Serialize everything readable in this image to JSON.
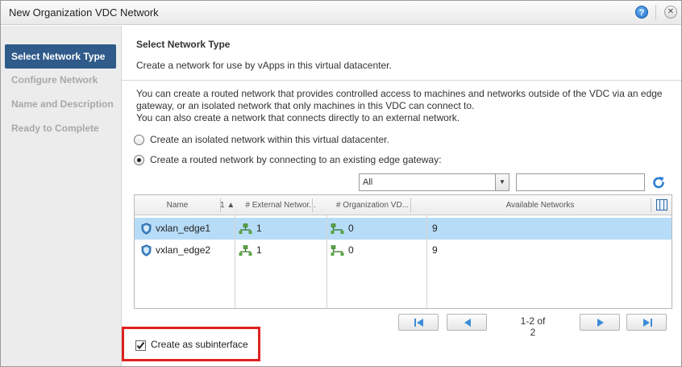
{
  "window": {
    "title": "New Organization VDC Network",
    "help_label": "?",
    "close_label": "⊗"
  },
  "steps": [
    {
      "label": "Select Network Type",
      "active": true
    },
    {
      "label": "Configure Network",
      "active": false
    },
    {
      "label": "Name and Description",
      "active": false
    },
    {
      "label": "Ready to Complete",
      "active": false
    }
  ],
  "page": {
    "title": "Select Network Type",
    "subtitle": "Create a network for use by vApps in this virtual datacenter.",
    "paragraph_lines": [
      "You can create a routed network that provides controlled access to machines and networks outside of the VDC via an edge",
      "gateway, or an isolated network that only machines in this VDC can connect to.",
      "You can also create a network that connects directly to an external network."
    ]
  },
  "options": [
    {
      "label": "Create an isolated network within this virtual datacenter.",
      "checked": false
    },
    {
      "label": "Create a routed network by connecting to an existing edge gateway:",
      "checked": true
    }
  ],
  "filter": {
    "select_value": "All",
    "search_value": "",
    "search_placeholder": ""
  },
  "grid": {
    "columns": [
      "Name",
      "1 ▲",
      "# External Networ...",
      "# Organization VD...",
      "Available Networks"
    ],
    "rows": [
      {
        "name": "vxlan_edge1",
        "external": "1",
        "org_vdc": "0",
        "available": "9",
        "selected": true
      },
      {
        "name": "vxlan_edge2",
        "external": "1",
        "org_vdc": "0",
        "available": "9",
        "selected": false
      }
    ]
  },
  "pager": {
    "info": "1-2 of 2"
  },
  "subinterface": {
    "label": "Create as subinterface",
    "checked": true
  },
  "colors": {
    "active_step": "#2f5a8a",
    "selected_row": "#b7dcf7",
    "highlight_box": "#e02020",
    "accent_blue": "#2d6aa8"
  },
  "icons": {
    "help": "help-icon",
    "close": "close-icon",
    "refresh": "refresh-icon",
    "edge_gateway": "shield-icon",
    "network": "network-icon",
    "columns": "columns-icon"
  }
}
